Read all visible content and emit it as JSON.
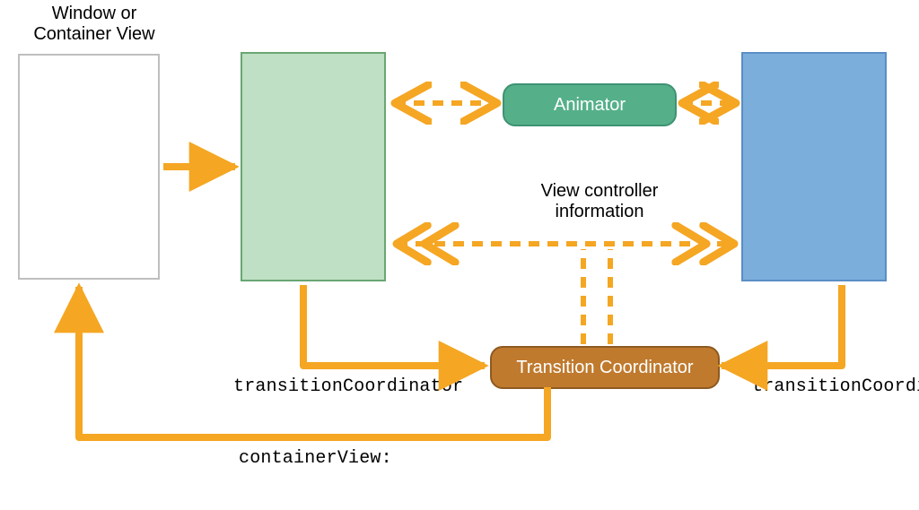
{
  "title": "Window or\nContainer View",
  "animator": {
    "label": "Animator"
  },
  "coordinator": {
    "label": "Transition Coordinator"
  },
  "labels": {
    "vc_info": "View controller\ninformation",
    "tc_left": "transitionCoordinator",
    "tc_right": "transitionCoordinator",
    "container_view": "containerView:"
  },
  "colors": {
    "orange": "#F5A623",
    "green_box": "#BFE0C4",
    "green_box_border": "#69A673",
    "blue_box": "#7BAEDB",
    "blue_box_border": "#5A8EC6",
    "animator_fill": "#55B08A",
    "animator_border": "#3E9273",
    "coord_fill": "#C07A2E",
    "coord_border": "#8E5A20",
    "window_border": "#BFBFBF"
  },
  "diagram_data": {
    "type": "architecture-diagram",
    "nodes": [
      {
        "id": "window",
        "label": "Window or Container View",
        "kind": "container"
      },
      {
        "id": "green_vc",
        "label": "",
        "kind": "view-controller"
      },
      {
        "id": "blue_vc",
        "label": "",
        "kind": "view-controller"
      },
      {
        "id": "animator",
        "label": "Animator",
        "kind": "object"
      },
      {
        "id": "coordinator",
        "label": "Transition Coordinator",
        "kind": "object"
      }
    ],
    "edges": [
      {
        "from": "window",
        "to": "green_vc",
        "style": "solid",
        "arrow": "forward",
        "label": ""
      },
      {
        "from": "green_vc",
        "to": "animator",
        "style": "dashed",
        "arrow": "both",
        "label": ""
      },
      {
        "from": "animator",
        "to": "blue_vc",
        "style": "dashed",
        "arrow": "both",
        "label": ""
      },
      {
        "from": "green_vc",
        "to": "blue_vc",
        "style": "dashed",
        "arrow": "both-double",
        "label": "View controller information"
      },
      {
        "from": "green_vc",
        "to": "coordinator",
        "style": "solid",
        "arrow": "forward",
        "label": "transitionCoordinator"
      },
      {
        "from": "blue_vc",
        "to": "coordinator",
        "style": "solid",
        "arrow": "forward",
        "label": "transitionCoordinator"
      },
      {
        "from": "coordinator",
        "to": "window",
        "style": "solid",
        "arrow": "forward",
        "label": "containerView:"
      },
      {
        "from": "coordinator",
        "to": "__info__",
        "style": "dashed",
        "arrow": "none",
        "label": ""
      }
    ]
  }
}
